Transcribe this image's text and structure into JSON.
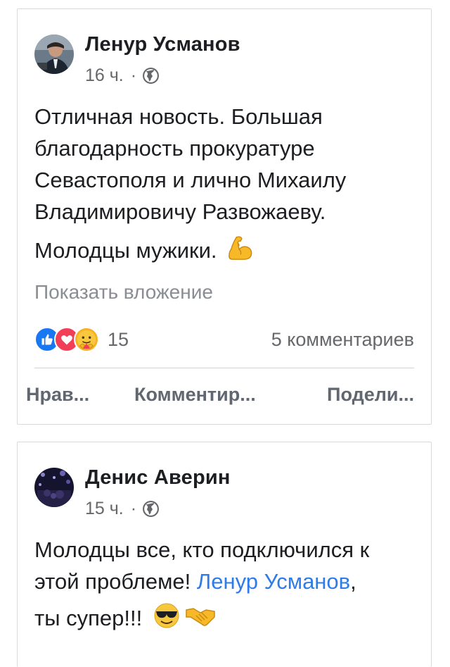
{
  "posts": [
    {
      "author": "Ленур Усманов",
      "time": "16 ч.",
      "separator": "·",
      "body_lines": [
        "Отличная новость. Большая",
        "благодарность прокуратуре",
        "Севастополя и лично Михаилу",
        "Владимировичу Развожаеву.",
        "Молодцы мужики."
      ],
      "body_emoji": "flexed-biceps-emoji",
      "show_attachment": "Показать вложение",
      "reactions": {
        "icons": [
          "like-icon",
          "love-icon",
          "care-icon"
        ],
        "count": "15"
      },
      "comments": "5 комментариев",
      "actions": {
        "like": "Нрав...",
        "comment": "Комментир...",
        "share": "Подели..."
      }
    },
    {
      "author": "Денис Аверин",
      "time": "15 ч.",
      "separator": "·",
      "body_line_1": "Молодцы все, кто подключился к",
      "body_line_2_prefix": "этой проблеме!",
      "mention": "Ленур Усманов",
      "body_line_2_suffix": ",",
      "body_line_3": "ты супер!!!",
      "body_emojis": [
        "smiling-face-with-sunglasses-emoji",
        "handshake-emoji"
      ]
    }
  ],
  "colors": {
    "mention": "#2f7ce8",
    "meta": "#65676b",
    "like": "#1877f2",
    "love": "#f33e58",
    "care": "#f7b125"
  }
}
